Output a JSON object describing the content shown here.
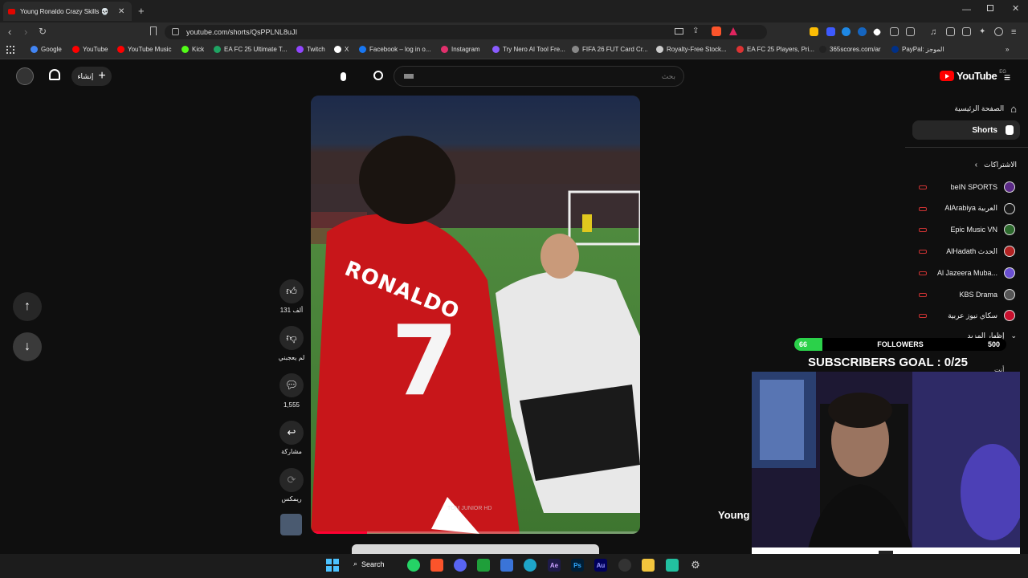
{
  "browser": {
    "tab_title": "Young Ronaldo Crazy Skills 💀",
    "url": "youtube.com/shorts/QsPPLNL8uJI",
    "bookmarks": [
      {
        "label": "Google",
        "color": "#4285f4"
      },
      {
        "label": "YouTube",
        "color": "#ff0000"
      },
      {
        "label": "YouTube Music",
        "color": "#ff0000"
      },
      {
        "label": "Kick",
        "color": "#53fc18"
      },
      {
        "label": "EA FC 25 Ultimate T...",
        "color": "#1fa463"
      },
      {
        "label": "Twitch",
        "color": "#9146ff"
      },
      {
        "label": "X",
        "color": "#ffffff"
      },
      {
        "label": "Facebook – log in o...",
        "color": "#1877f2"
      },
      {
        "label": "Instagram",
        "color": "#e1306c"
      },
      {
        "label": "Try Nero AI Tool Fre...",
        "color": "#8a5cff"
      },
      {
        "label": "FIFA 26 FUT Card Cr...",
        "color": "#888888"
      },
      {
        "label": "Royalty-Free Stock...",
        "color": "#cccccc"
      },
      {
        "label": "EA FC 25 Players, Pri...",
        "color": "#d33"
      },
      {
        "label": "365scores.com/ar",
        "color": "#222222"
      },
      {
        "label": "PayPal: الموجز",
        "color": "#003087"
      }
    ]
  },
  "youtube": {
    "create_label": "إنشاء",
    "search_placeholder": "بحث",
    "logo_text": "YouTube",
    "logo_region": "EG",
    "nav": {
      "home": "الصفحة الرئيسية",
      "shorts": "Shorts",
      "subscriptions": "الاشتراكات",
      "show_more": "إظهار المزيد",
      "you": "أنت"
    },
    "channels": [
      {
        "name": "beIN SPORTS",
        "color": "#5b2a86"
      },
      {
        "name": "AlArabiya العربية",
        "color": "#1a1a1a"
      },
      {
        "name": "Epic Music VN",
        "color": "#2d6a2d"
      },
      {
        "name": "AlHadath الحدث",
        "color": "#b22222"
      },
      {
        "name": "Al Jazeera Muba...",
        "color": "#6a4fd1"
      },
      {
        "name": "KBS Drama",
        "color": "#555555"
      },
      {
        "name": "سكاي نيوز عربية",
        "color": "#c8102e"
      }
    ],
    "actions": {
      "likes": "131 ألف",
      "dislike": "لم يعجبني",
      "comments": "1,555",
      "share": "مشاركة",
      "remix": "ريمكس"
    },
    "video": {
      "jersey_name": "RONALDO",
      "jersey_number": "7",
      "watermark": "TOM JUNIOR HD",
      "progress": 0.17
    }
  },
  "overlay": {
    "followers_current": "66",
    "followers_label": "FOLLOWERS",
    "followers_target": "500",
    "followers_progress": 0.132,
    "subscribers_goal": "SUBSCRIBERS GOAL : 0/25",
    "caption": "Young",
    "you_label": "أنت"
  }
}
